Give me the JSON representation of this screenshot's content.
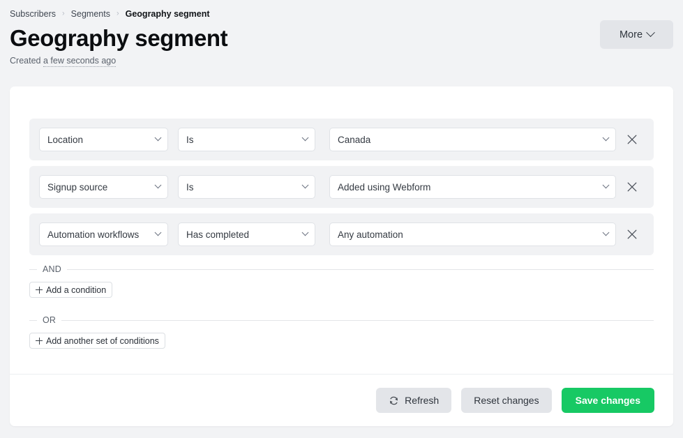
{
  "breadcrumb": {
    "items": [
      {
        "label": "Subscribers",
        "current": false
      },
      {
        "label": "Segments",
        "current": false
      },
      {
        "label": "Geography segment",
        "current": true
      }
    ],
    "separator": "›"
  },
  "header": {
    "title": "Geography segment",
    "created_prefix": "Created",
    "created_relative": "a few seconds ago",
    "more_label": "More",
    "more_icon": "chevron-down-icon"
  },
  "conditions": {
    "rows": [
      {
        "field": "Location",
        "operator": "Is",
        "value": "Canada",
        "remove_icon": "close-icon"
      },
      {
        "field": "Signup source",
        "operator": "Is",
        "value": "Added using Webform",
        "remove_icon": "close-icon"
      },
      {
        "field": "Automation workflows",
        "operator": "Has completed",
        "value": "Any automation",
        "remove_icon": "close-icon"
      }
    ],
    "and_label": "AND",
    "or_label": "OR",
    "add_condition_label": "Add a condition",
    "add_set_label": "Add another set of conditions",
    "add_icon": "plus-icon"
  },
  "footer": {
    "refresh_label": "Refresh",
    "refresh_icon": "refresh-icon",
    "reset_label": "Reset changes",
    "save_label": "Save changes"
  },
  "colors": {
    "page_background": "#f2f3f5",
    "card_background": "#ffffff",
    "row_background": "#f1f2f4",
    "primary_green": "#17c964",
    "secondary_gray": "#e3e5e9",
    "text_primary": "#0b0d10",
    "text_muted": "#5b626c",
    "border": "#dfe2e6"
  }
}
